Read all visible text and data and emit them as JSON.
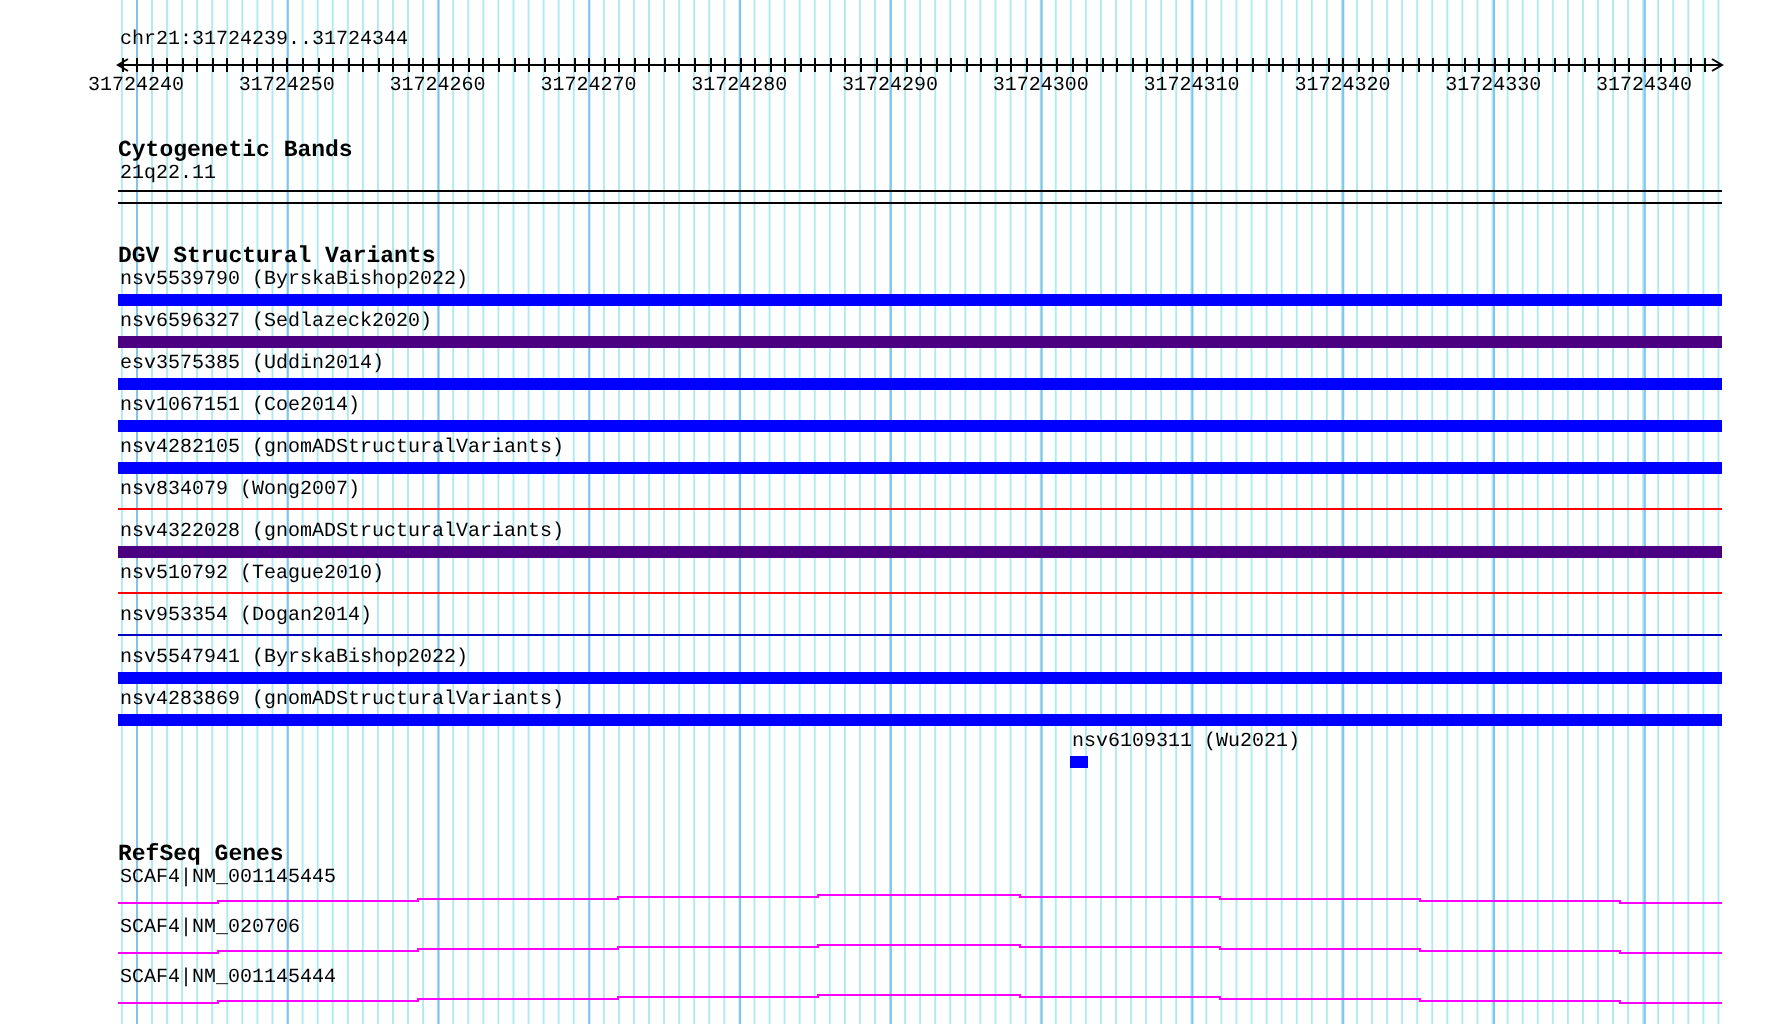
{
  "location": "chr21:31724239..31724344",
  "ruler": {
    "labels": [
      "31724240",
      "31724250",
      "31724260",
      "31724270",
      "31724280",
      "31724290",
      "31724300",
      "31724310",
      "31724320",
      "31724330",
      "31724340"
    ]
  },
  "tracks": [
    {
      "kind": "bands",
      "title": "Cytogenetic Bands",
      "features": [
        {
          "label": "21q22.11"
        }
      ]
    },
    {
      "kind": "variants",
      "title": "DGV Structural Variants",
      "features": [
        {
          "label": "nsv5539790 (ByrskaBishop2022)",
          "kind": "bar",
          "color": "#0000ff"
        },
        {
          "label": "nsv6596327 (Sedlazeck2020)",
          "kind": "bar",
          "color": "#4b0082"
        },
        {
          "label": "esv3575385 (Uddin2014)",
          "kind": "bar",
          "color": "#0000ff"
        },
        {
          "label": "nsv1067151 (Coe2014)",
          "kind": "bar",
          "color": "#0000ff"
        },
        {
          "label": "nsv4282105 (gnomADStructuralVariants)",
          "kind": "bar",
          "color": "#0000ff"
        },
        {
          "label": "nsv834079 (Wong2007)",
          "kind": "line",
          "color": "#ff0000"
        },
        {
          "label": "nsv4322028 (gnomADStructuralVariants)",
          "kind": "bar",
          "color": "#4b0082"
        },
        {
          "label": "nsv510792 (Teague2010)",
          "kind": "line",
          "color": "#ff0000"
        },
        {
          "label": "nsv953354 (Dogan2014)",
          "kind": "line",
          "color": "#0000c0"
        },
        {
          "label": "nsv5547941 (ByrskaBishop2022)",
          "kind": "bar",
          "color": "#0000ff"
        },
        {
          "label": "nsv4283869 (gnomADStructuralVariants)",
          "kind": "bar",
          "color": "#0000ff"
        },
        {
          "label": "nsv6109311 (Wu2021)",
          "kind": "box",
          "color": "#0000ff"
        }
      ]
    },
    {
      "kind": "genes",
      "title": "RefSeq Genes",
      "features": [
        {
          "label": "SCAF4|NM_001145445"
        },
        {
          "label": "SCAF4|NM_020706"
        },
        {
          "label": "SCAF4|NM_001145444"
        }
      ]
    }
  ]
}
